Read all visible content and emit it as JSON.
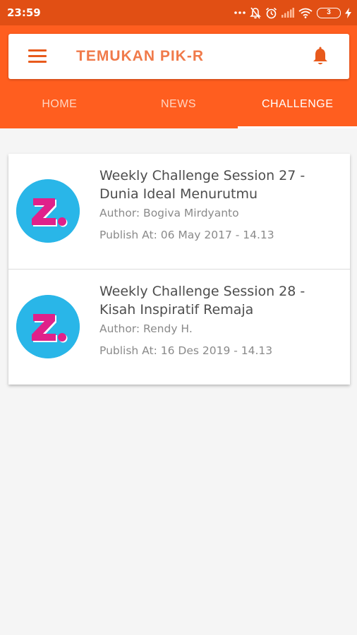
{
  "status_bar": {
    "time": "23:59",
    "battery_level": "3",
    "icons": [
      "more-dots-icon",
      "notifications-off-icon",
      "alarm-icon",
      "signal-icon",
      "wifi-icon",
      "battery-icon",
      "charging-icon"
    ]
  },
  "app_bar": {
    "title": "TEMUKAN PIK-R",
    "menu_icon": "menu-icon",
    "notification_icon": "bell-icon",
    "color": "#ff5e1f"
  },
  "tabs": [
    {
      "label": "HOME",
      "active": false
    },
    {
      "label": "NEWS",
      "active": false
    },
    {
      "label": "CHALLENGE",
      "active": true
    }
  ],
  "challenges": [
    {
      "title": "Weekly Challenge Session 27 - Dunia Ideal Menurutmu",
      "author": "Author: Bogiva Mirdyanto",
      "published": "Publish At: 06 May 2017 - 14.13"
    },
    {
      "title": "Weekly Challenge Session 28 - Kisah Inspiratif Remaja",
      "author": "Author: Rendy H.",
      "published": "Publish At: 16 Des 2019 - 14.13"
    }
  ],
  "colors": {
    "status_bar": "#e14f14",
    "accent": "#ff5e1f",
    "logo_background": "#29b6e8",
    "logo_letter": "#e0218a"
  }
}
